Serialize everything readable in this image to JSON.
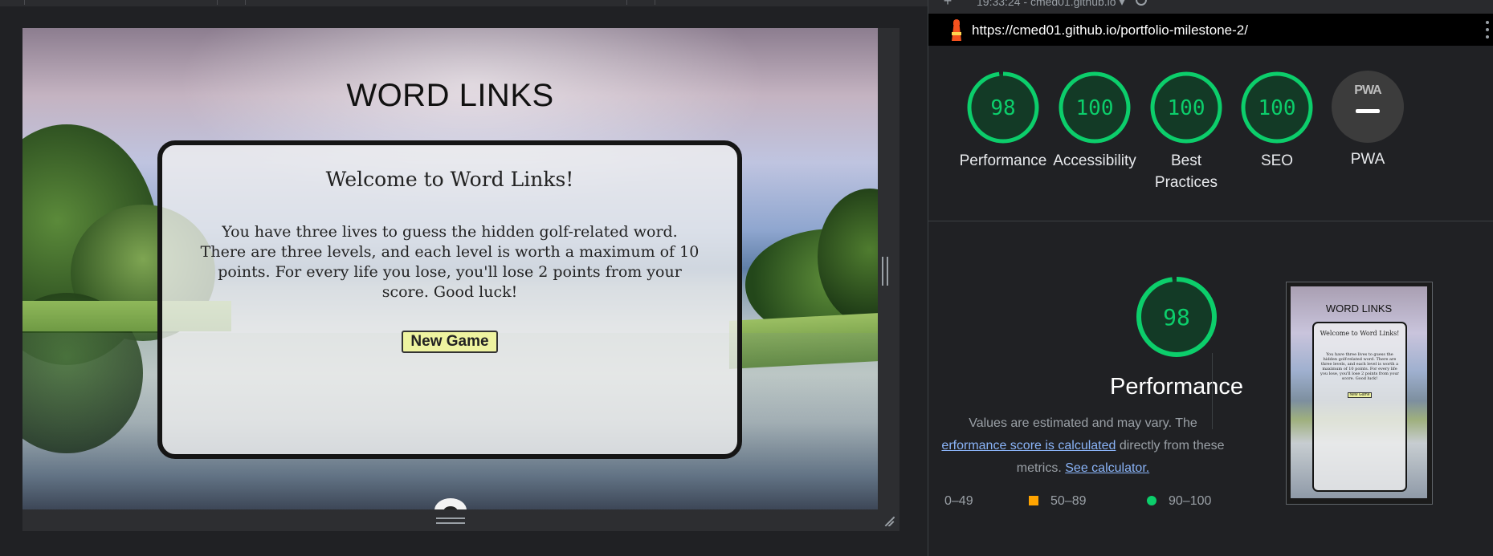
{
  "preview": {
    "title": "WORD LINKS",
    "card": {
      "heading": "Welcome to Word Links!",
      "text": "You have three lives to guess the hidden golf-related word. There are three levels, and each level is worth a maximum of 10 points. For every life you lose, you'll lose 2 points from your score. Good luck!",
      "button_label": "New Game"
    }
  },
  "lighthouse": {
    "report_selector": "19:33:24 - cmed01.github.io",
    "url": "https://cmed01.github.io/portfolio-milestone-2/",
    "categories": [
      {
        "label": "Performance",
        "score": 98
      },
      {
        "label": "Accessibility",
        "score": 100
      },
      {
        "label": "Best Practices",
        "score": 100
      },
      {
        "label": "SEO",
        "score": 100
      },
      {
        "label": "PWA",
        "badge": "PWA"
      }
    ],
    "detail": {
      "score": 98,
      "label": "Performance",
      "note_line1": "Values are estimated and may vary. The",
      "note_link1": "erformance score is calculated",
      "note_after_link1": " directly from these",
      "note_line3_prefix": "metrics. ",
      "note_link2": "See calculator."
    },
    "legend": [
      {
        "range": "0–49",
        "color": "#ff4e42"
      },
      {
        "range": "50–89",
        "color": "#ffa400"
      },
      {
        "range": "90–100",
        "color": "#0cce6b"
      }
    ],
    "pass_color": "#0cce6b"
  }
}
